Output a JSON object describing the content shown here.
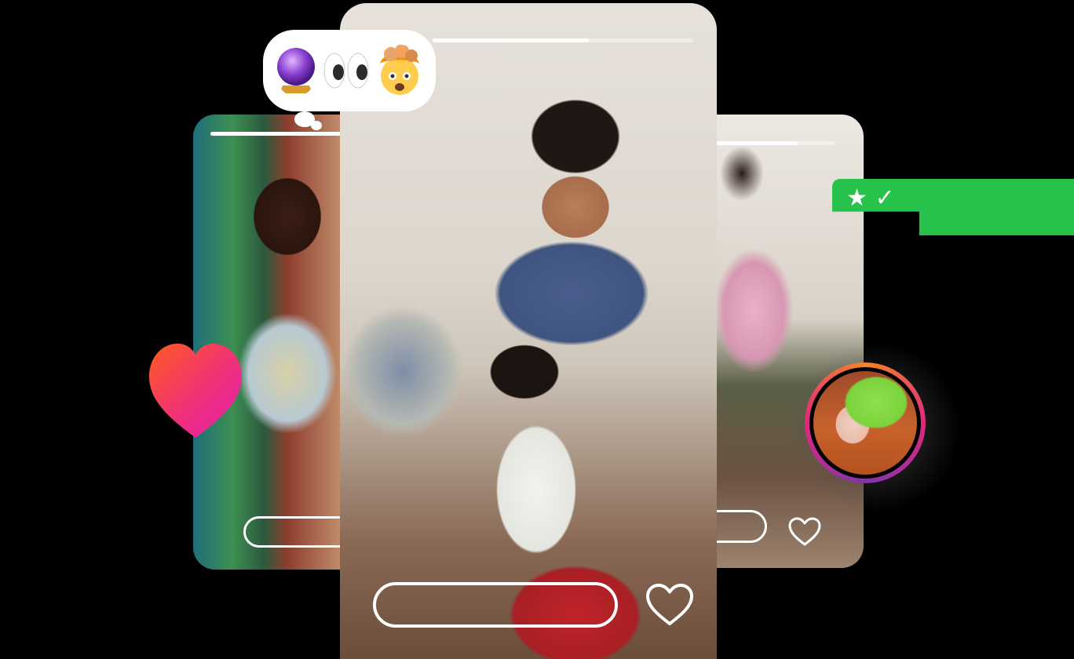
{
  "stories": {
    "left": {
      "progress": 1.0
    },
    "center": {
      "progress": 0.6
    },
    "right": {
      "progress": 0.7
    }
  },
  "emoji_reaction": {
    "emojis": [
      "crystal-ball",
      "eyes",
      "exploding-head"
    ]
  },
  "badge": {
    "text": "★ ✓"
  },
  "colors": {
    "badge_green": "#27c24c",
    "heart_gradient_start": "#ff5a1f",
    "heart_gradient_end": "#e11fb0",
    "ring_gradient": [
      "#f58529",
      "#dd2a7b",
      "#8134af"
    ]
  }
}
